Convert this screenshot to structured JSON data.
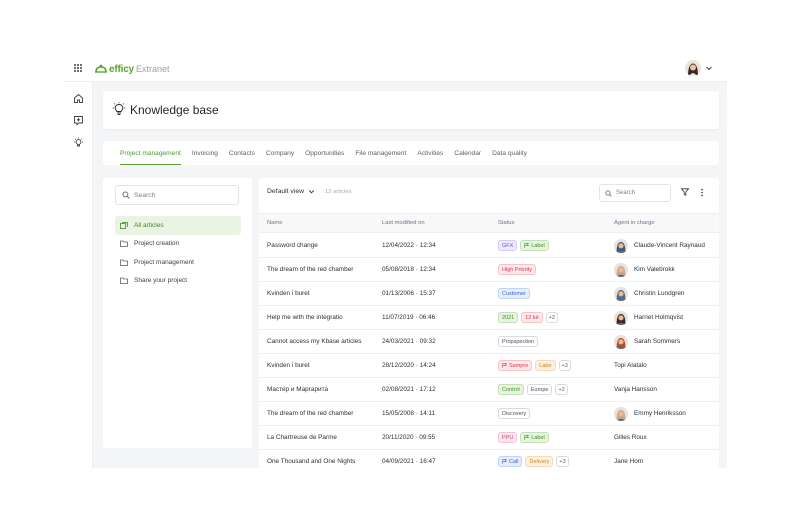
{
  "app": {
    "brand": "efficy",
    "product": "Extranet"
  },
  "header": {
    "title": "Knowledge base"
  },
  "tabs": [
    {
      "label": "Project management",
      "active": true
    },
    {
      "label": "Invoicing"
    },
    {
      "label": "Contacts"
    },
    {
      "label": "Company"
    },
    {
      "label": "Opportunities"
    },
    {
      "label": "File management"
    },
    {
      "label": "Activities"
    },
    {
      "label": "Calendar"
    },
    {
      "label": "Data quality"
    }
  ],
  "left_panel": {
    "search_placeholder": "Search",
    "folders": [
      {
        "label": "All articles",
        "active": true,
        "icon": "stack-icon"
      },
      {
        "label": "Project creation",
        "icon": "folder-icon"
      },
      {
        "label": "Project management",
        "icon": "folder-icon"
      },
      {
        "label": "Share your project",
        "icon": "folder-icon"
      }
    ]
  },
  "toolbar": {
    "view": "Default view",
    "count": "12 articles",
    "search_placeholder": "Search"
  },
  "table": {
    "columns": [
      "Name",
      "Last modified on",
      "Status",
      "Agent in charge"
    ],
    "rows": [
      {
        "name": "Password change",
        "date": "12/04/2022 · 12:34",
        "tags": [
          {
            "text": "GFX",
            "style": "purple"
          },
          {
            "text": "Label",
            "style": "green",
            "icon": "flag"
          }
        ],
        "plus": "",
        "agent": "Claude-Vincent Raynaud",
        "avatar": "#3a5a7a"
      },
      {
        "name": "The dream of the red chamber",
        "date": "05/08/2018 · 12:34",
        "tags": [
          {
            "text": "High Priority",
            "style": "red"
          }
        ],
        "plus": "",
        "agent": "Kim Valebrokk",
        "avatar": "#c9a48a"
      },
      {
        "name": "Kvinden i buret",
        "date": "01/13/2006 · 15:37",
        "tags": [
          {
            "text": "Customer",
            "style": "blue"
          }
        ],
        "plus": "",
        "agent": "Christin Lundgren",
        "avatar": "#4a6e8c"
      },
      {
        "name": "Help me with the integratio",
        "date": "11/07/2019 · 06:46",
        "tags": [
          {
            "text": "2021",
            "style": "green"
          },
          {
            "text": "12 ké",
            "style": "red"
          }
        ],
        "plus": "+2",
        "agent": "Harriet Holmqvist",
        "avatar": "#3b2a22"
      },
      {
        "name": "Cannot access my Kbase articles",
        "date": "24/03/2021 · 09:32",
        "tags": [
          {
            "text": "Propspection",
            "style": "gray"
          }
        ],
        "plus": "",
        "agent": "Sarah Sommers",
        "avatar": "#b0502e"
      },
      {
        "name": "Kvinden i buret",
        "date": "28/12/2020 · 14:24",
        "tags": [
          {
            "text": "Sampre",
            "style": "red",
            "icon": "flag"
          },
          {
            "text": "Labe",
            "style": "orange"
          }
        ],
        "plus": "+3",
        "agent": "Topi Alatalo",
        "avatar": ""
      },
      {
        "name": "Мастер и Маргарита",
        "date": "02/08/2021 · 17:12",
        "tags": [
          {
            "text": "Control",
            "style": "green"
          },
          {
            "text": "Europe",
            "style": "gray"
          }
        ],
        "plus": "+2",
        "agent": "Vanja Hansson",
        "avatar": ""
      },
      {
        "name": "The dream of the red chamber",
        "date": "15/05/2008 · 14:11",
        "tags": [
          {
            "text": "Discovery",
            "style": "gray"
          }
        ],
        "plus": "",
        "agent": "Emmy Henriksson",
        "avatar": "#c8a98c"
      },
      {
        "name": "La Chartreuse de Parme",
        "date": "20/11/2020 · 09:55",
        "tags": [
          {
            "text": "PPU",
            "style": "pink"
          },
          {
            "text": "Label",
            "style": "green",
            "icon": "flag"
          }
        ],
        "plus": "",
        "agent": "Gilles Roux",
        "avatar": ""
      },
      {
        "name": "One Thousand and One Nights",
        "date": "04/09/2021 · 16:47",
        "tags": [
          {
            "text": "Call",
            "style": "blue",
            "icon": "flag"
          },
          {
            "text": "Delivery",
            "style": "orange"
          }
        ],
        "plus": "+3",
        "agent": "Jane Horn",
        "avatar": ""
      }
    ]
  },
  "colors": {
    "accent": "#5aa532",
    "tag_purple_bg": "#efeafd",
    "tag_purple_fg": "#6a4fd1",
    "tag_green_bg": "#e6f4e0",
    "tag_green_fg": "#3f8f22",
    "tag_red_bg": "#fde8ea",
    "tag_red_fg": "#d2384a",
    "tag_blue_bg": "#e5eefc",
    "tag_blue_fg": "#3566c9",
    "tag_orange_bg": "#fdf0e0",
    "tag_orange_fg": "#d58520",
    "tag_gray_bg": "#ffffff",
    "tag_gray_fg": "#4b5058",
    "tag_pink_bg": "#fde6ef",
    "tag_pink_fg": "#d23e7a"
  }
}
